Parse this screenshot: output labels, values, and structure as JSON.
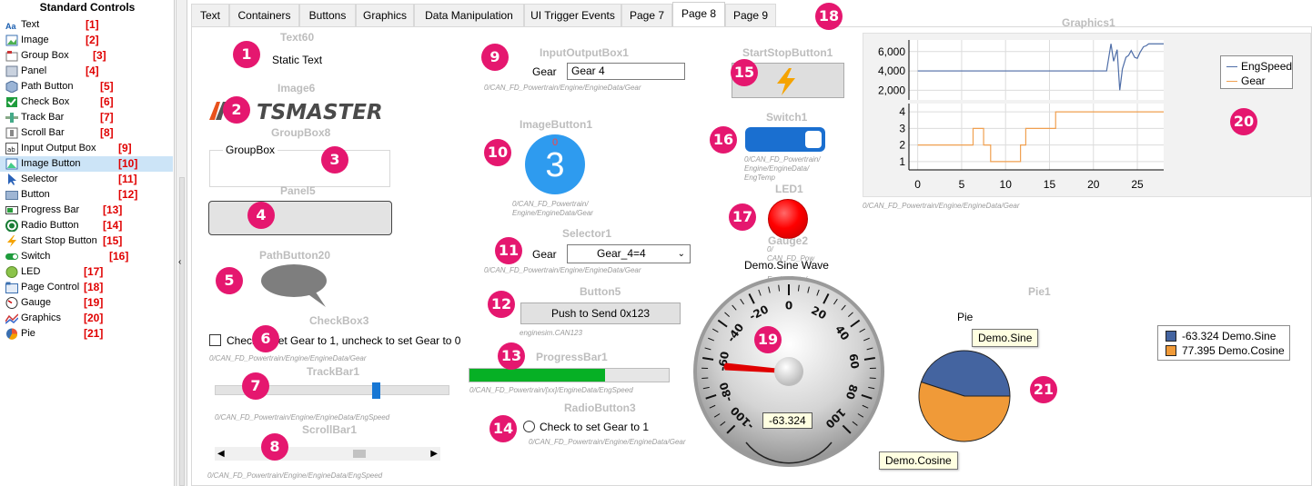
{
  "palette": {
    "title": "Standard Controls",
    "items": [
      {
        "label": "Text",
        "num": "[1]",
        "icon": "text-icon"
      },
      {
        "label": "Image",
        "num": "[2]",
        "icon": "image-icon"
      },
      {
        "label": "Group Box",
        "num": "[3]",
        "icon": "group-box-icon"
      },
      {
        "label": "Panel",
        "num": "[4]",
        "icon": "panel-icon"
      },
      {
        "label": "Path Button",
        "num": "[5]",
        "icon": "path-button-icon"
      },
      {
        "label": "Check Box",
        "num": "[6]",
        "icon": "check-box-icon"
      },
      {
        "label": "Track Bar",
        "num": "[7]",
        "icon": "track-bar-icon"
      },
      {
        "label": "Scroll Bar",
        "num": "[8]",
        "icon": "scroll-bar-icon"
      },
      {
        "label": "Input Output Box",
        "num": "[9]",
        "icon": "input-output-box-icon"
      },
      {
        "label": "Image Button",
        "num": "[10]",
        "icon": "image-button-icon"
      },
      {
        "label": "Selector",
        "num": "[11]",
        "icon": "selector-icon"
      },
      {
        "label": "Button",
        "num": "[12]",
        "icon": "button-icon"
      },
      {
        "label": "Progress Bar",
        "num": "[13]",
        "icon": "progress-bar-icon"
      },
      {
        "label": "Radio Button",
        "num": "[14]",
        "icon": "radio-button-icon"
      },
      {
        "label": "Start Stop Button",
        "num": "[15]",
        "icon": "start-stop-button-icon"
      },
      {
        "label": "Switch",
        "num": "[16]",
        "icon": "switch-icon"
      },
      {
        "label": "LED",
        "num": "[17]",
        "icon": "led-icon"
      },
      {
        "label": "Page Control",
        "num": "[18]",
        "icon": "page-control-icon"
      },
      {
        "label": "Gauge",
        "num": "[19]",
        "icon": "gauge-icon"
      },
      {
        "label": "Graphics",
        "num": "[20]",
        "icon": "graphics-icon"
      },
      {
        "label": "Pie",
        "num": "[21]",
        "icon": "pie-icon"
      }
    ],
    "selected": "Image Button"
  },
  "tabs": [
    "Text",
    "Containers",
    "Buttons",
    "Graphics",
    "Data Manipulation",
    "UI Trigger Events",
    "Page 7",
    "Page 8",
    "Page 9"
  ],
  "active_tab": "Page 8",
  "badges": [
    "1",
    "2",
    "3",
    "4",
    "5",
    "6",
    "7",
    "8",
    "9",
    "10",
    "11",
    "12",
    "13",
    "14",
    "15",
    "16",
    "17",
    "18",
    "19",
    "20",
    "21"
  ],
  "text60": {
    "title": "Text60",
    "value": "Static Text"
  },
  "image6": {
    "title": "Image6",
    "logo_text": "TSMASTER"
  },
  "groupbox8": {
    "title": "GroupBox8",
    "caption": "GroupBox"
  },
  "panel5": {
    "title": "Panel5"
  },
  "pathbutton20": {
    "title": "PathButton20"
  },
  "checkbox3": {
    "title": "CheckBox3",
    "label": "Check to set Gear to 1, uncheck to set Gear to 0",
    "checked": false,
    "signal": "0/CAN_FD_Powertrain/Engine/EngineData/Gear"
  },
  "trackbar1": {
    "title": "TrackBar1",
    "signal": "0/CAN_FD_Powertrain/Engine/EngineData/EngSpeed",
    "position_fraction": 0.67
  },
  "scrollbar1": {
    "title": "ScrollBar1",
    "signal": "0/CAN_FD_Powertrain/Engine/EngineData/EngSpeed",
    "position_fraction": 0.63
  },
  "ioBox1": {
    "title": "InputOutputBox1",
    "label": "Gear",
    "value": "Gear 4",
    "signal": "0/CAN_FD_Powertrain/Engine/EngineData/Gear"
  },
  "imageButton1": {
    "title": "ImageButton1",
    "top_value": "0",
    "value": "3",
    "signal_lines": [
      "0/CAN_FD_Powertrain/",
      "Engine/EngineData/Gear"
    ]
  },
  "selector1": {
    "title": "Selector1",
    "label": "Gear",
    "value": "Gear_4=4",
    "signal": "0/CAN_FD_Powertrain/Engine/EngineData/Gear"
  },
  "button5": {
    "title": "Button5",
    "label": "Push to Send 0x123",
    "signal": "enginesim.CAN123"
  },
  "progressBar1": {
    "title": "ProgressBar1",
    "value_fraction": 0.68,
    "signal": "0/CAN_FD_Powertrain/[xx]/EngineData/EngSpeed"
  },
  "radioButton3": {
    "title": "RadioButton3",
    "label": "Check to set Gear to 1",
    "checked": false,
    "signal": "0/CAN_FD_Powertrain/Engine/EngineData/Gear"
  },
  "startStopButton1": {
    "title": "StartStopButton1"
  },
  "switch1": {
    "title": "Switch1",
    "on": true,
    "signal_lines": [
      "0/CAN_FD_Powertrain/",
      "Engine/EngineData/",
      "EngTemp"
    ]
  },
  "led1": {
    "title": "LED1",
    "color": "#ff0000",
    "signal_lines": [
      "0/",
      "CAN_FD_Pow",
      "EngineData/"
    ]
  },
  "gauge2": {
    "title": "Gauge2",
    "caption": "Demo.Sine Wave",
    "value": "-63.324",
    "value_num": -63.324,
    "min": -100,
    "max": 100,
    "major_ticks": [
      "-100",
      "-80",
      "-60",
      "-40",
      "-20",
      "0",
      "20",
      "40",
      "60",
      "80",
      "100"
    ]
  },
  "graphics": {
    "title": "Graphics1",
    "signal": "0/CAN_FD_Powertrain/Engine/EngineData/Gear",
    "legend": [
      "EngSpeed",
      "Gear"
    ],
    "colors": {
      "engspeed": "#4f6ea8",
      "gear": "#f0a050"
    }
  },
  "pie1": {
    "title": "Pie1",
    "caption": "Pie",
    "legend": [
      {
        "label": "-63.324 Demo.Sine",
        "color": "#4464a0"
      },
      {
        "label": "77.395 Demo.Cosine",
        "color": "#f09a38"
      }
    ],
    "callout_sine": "Demo.Sine",
    "callout_cosine": "Demo.Cosine"
  },
  "chart_data": {
    "type": "line",
    "xlabel": "",
    "ylabel": "",
    "xlim": [
      -1,
      28
    ],
    "xticks": [
      "0",
      "5",
      "10",
      "15",
      "20",
      "25"
    ],
    "panels": [
      {
        "yticks": [
          "2,000",
          "4,000",
          "6,000"
        ],
        "ylim": [
          1000,
          7200
        ],
        "series": [
          {
            "name": "EngSpeed",
            "x": [
              0,
              5,
              10,
              15,
              20,
              21.5,
              22,
              22.3,
              22.7,
              23,
              23.3,
              23.7,
              24,
              24.3,
              24.7,
              25,
              25.3,
              25.7,
              26,
              26.3,
              26.7,
              27,
              28
            ],
            "y": [
              4000,
              4000,
              4000,
              4000,
              4000,
              4000,
              6800,
              5000,
              6200,
              2000,
              4200,
              5400,
              5600,
              6100,
              5400,
              5300,
              5900,
              6500,
              6600,
              6800,
              6800,
              6800,
              6800
            ]
          }
        ]
      },
      {
        "yticks": [
          "1",
          "2",
          "3",
          "4"
        ],
        "ylim": [
          0.5,
          4.5
        ],
        "series": [
          {
            "name": "Gear",
            "x": [
              0,
              6.3,
              6.3,
              7.5,
              7.5,
              8.3,
              8.3,
              11.7,
              11.7,
              12.3,
              12.3,
              15.7,
              15.7,
              28
            ],
            "y": [
              2,
              2,
              3,
              3,
              2,
              2,
              1,
              1,
              2,
              2,
              3,
              3,
              4,
              4
            ]
          }
        ]
      }
    ]
  }
}
